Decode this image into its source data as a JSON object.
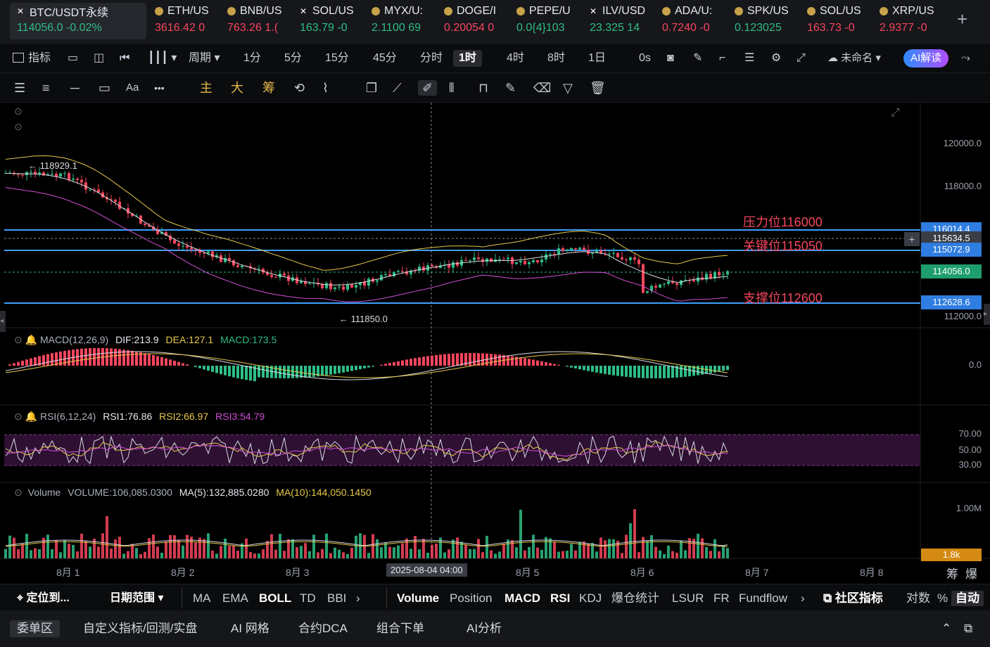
{
  "tickers": [
    {
      "symbol": "BTC/USDT永续",
      "price": "114056.0",
      "change": "-0.02%",
      "dir": "up",
      "icon": "x-icon",
      "active": true
    },
    {
      "symbol": "ETH/US",
      "price": "3616.42",
      "change": "0",
      "dir": "down",
      "icon": "coin-icon"
    },
    {
      "symbol": "BNB/US",
      "price": "763.26",
      "change": "1.(",
      "dir": "down",
      "icon": "coin-icon"
    },
    {
      "symbol": "SOL/US",
      "price": "163.79",
      "change": "-0",
      "dir": "up",
      "icon": "x-icon"
    },
    {
      "symbol": "MYX/U:",
      "price": "2.1100",
      "change": "69",
      "dir": "up",
      "icon": "coin-icon"
    },
    {
      "symbol": "DOGE/I",
      "price": "0.20054",
      "change": "0",
      "dir": "down",
      "icon": "coin-icon"
    },
    {
      "symbol": "PEPE/U",
      "price": "0.0{4}103",
      "change": "",
      "dir": "up",
      "icon": "coin-icon"
    },
    {
      "symbol": "ILV/USD",
      "price": "23.325",
      "change": "14",
      "dir": "up",
      "icon": "x-icon"
    },
    {
      "symbol": "ADA/U:",
      "price": "0.7240",
      "change": "-0",
      "dir": "down",
      "icon": "coin-icon"
    },
    {
      "symbol": "SPK/US",
      "price": "0.123025",
      "change": "",
      "dir": "up",
      "icon": "coin-icon"
    },
    {
      "symbol": "SOL/US",
      "price": "163.73",
      "change": "-0",
      "dir": "down",
      "icon": "coin-icon"
    },
    {
      "symbol": "XRP/US",
      "price": "2.9377",
      "change": "-0",
      "dir": "down",
      "icon": "coin-icon"
    }
  ],
  "add_tab": "+",
  "toolbar": {
    "indicators": "指标",
    "period": "周期",
    "intervals": [
      "1分",
      "5分",
      "15分",
      "45分",
      "分时",
      "1时",
      "4时",
      "8时",
      "1日"
    ],
    "selected_interval": "1时",
    "countdown": "0s",
    "layout_name": "未命名",
    "ai_button": "AI解读"
  },
  "drawbar": {
    "main": "主",
    "big": "大",
    "chips": "筹",
    "font": "Aa",
    "more": "•••"
  },
  "chart": {
    "price_axis": [
      "120000.0",
      "118000.0",
      "112000.0"
    ],
    "levels": [
      {
        "label": "压力位116000",
        "tag": "116014.4"
      },
      {
        "label": "关键位115050",
        "tag": "115072.9"
      },
      {
        "label": "支撑位112600",
        "tag": "112628.6"
      }
    ],
    "crosshair_price": "115634.5",
    "last_price": "114056.0",
    "high_mark": "← 118929.1",
    "low_mark": "← 111850.0",
    "macd_legend": {
      "name": "MACD(12,26,9)",
      "dif": "DIF:213.9",
      "dea": "DEA:127.1",
      "macd": "MACD:173.5",
      "axis": "0.0"
    },
    "rsi_legend": {
      "name": "RSI(6,12,24)",
      "rsi1": "RSI1:76.86",
      "rsi2": "RSI2:66.97",
      "rsi3": "RSI3:54.79",
      "axis": [
        "70.00",
        "50.00",
        "30.00"
      ]
    },
    "vol_legend": {
      "name": "Volume",
      "volume": "VOLUME:106,085.0300",
      "ma5": "MA(5):132,885.0280",
      "ma10": "MA(10):144,050.1450",
      "axis": "1.00M",
      "tag": "1.8k"
    },
    "dates": [
      "8月 1",
      "8月 2",
      "8月 3",
      "8月 5",
      "8月 6",
      "8月 7",
      "8月 8"
    ],
    "crosshair_time": "2025-08-04 04:00",
    "corner": [
      "筹",
      "爆"
    ]
  },
  "tabbar": {
    "locate": "定位到...",
    "date_range": "日期范围",
    "main_inds": [
      "MA",
      "EMA",
      "BOLL",
      "TD",
      "BBI"
    ],
    "active_main": "BOLL",
    "sub_inds": [
      "Volume",
      "Position",
      "MACD",
      "RSI",
      "KDJ",
      "爆仓统计",
      "LSUR",
      "FR",
      "Fundflow"
    ],
    "active_sub": [
      "Volume",
      "MACD",
      "RSI"
    ],
    "community": "社区指标",
    "log": "对数",
    "pct": "%",
    "auto": "自动"
  },
  "footer": {
    "items": [
      "委单区",
      "自定义指标/回测/实盘",
      "AI 网格",
      "合约DCA",
      "组合下单",
      "AI分析"
    ],
    "active": "委单区"
  },
  "colors": {
    "up": "#2ebd85",
    "down": "#f6465d",
    "accent": "#3b7dd8",
    "gold": "#e6b74a",
    "line_blue": "#3fa0ff"
  }
}
